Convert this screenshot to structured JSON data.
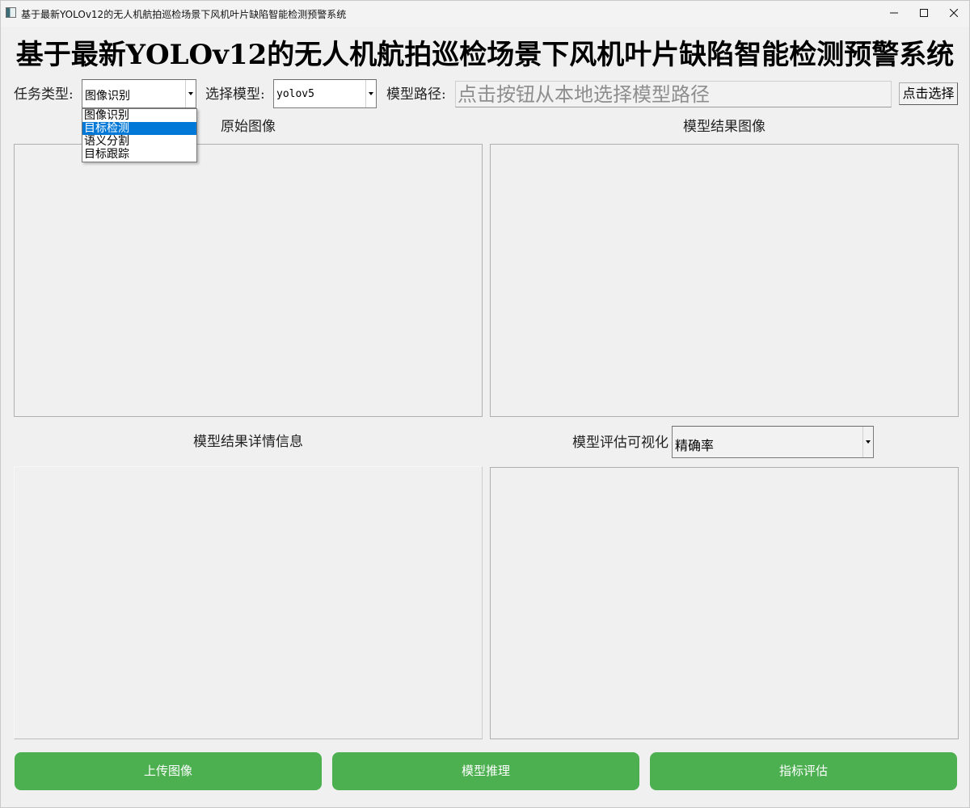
{
  "window": {
    "title": "基于最新YOLOv12的无人机航拍巡检场景下风机叶片缺陷智能检测预警系统",
    "minimize_icon": "minimize-icon",
    "maximize_icon": "maximize-icon",
    "close_icon": "close-icon"
  },
  "header": {
    "title": "基于最新YOLOv12的无人机航拍巡检场景下风机叶片缺陷智能检测预警系统"
  },
  "toolbar": {
    "task_type_label": "任务类型:",
    "task_type_value": "图像识别",
    "task_type_options": [
      "图像识别",
      "目标检测",
      "语义分割",
      "目标跟踪"
    ],
    "task_type_highlighted": "目标检测",
    "model_label": "选择模型:",
    "model_value": "yolov5",
    "model_path_label": "模型路径:",
    "model_path_placeholder": "点击按钮从本地选择模型路径",
    "select_button_label": "点击选择"
  },
  "panels": {
    "original_image_title": "原始图像",
    "result_image_title": "模型结果图像",
    "result_details_title": "模型结果详情信息",
    "eval_visual_label": "模型评估可视化",
    "eval_metric_value": "精确率"
  },
  "actions": {
    "upload_label": "上传图像",
    "inference_label": "模型推理",
    "evaluate_label": "指标评估"
  },
  "colors": {
    "button_green": "#4caf50",
    "dropdown_highlight": "#0078d7"
  }
}
